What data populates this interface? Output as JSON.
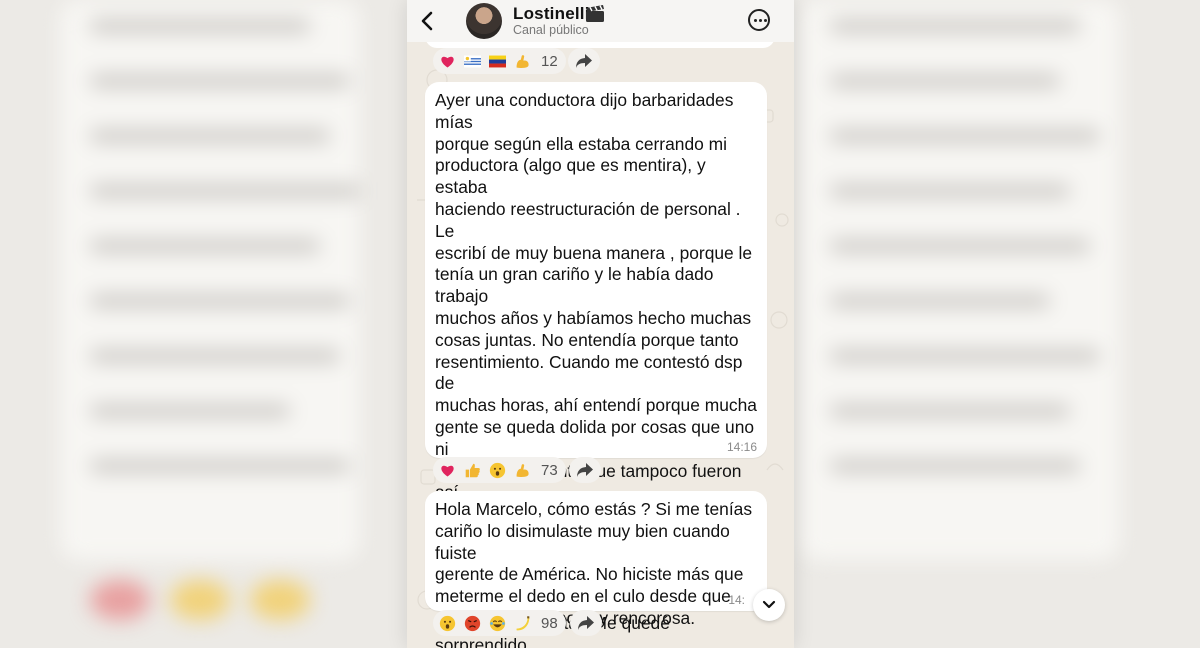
{
  "header": {
    "channel_name": "Lostinelli",
    "channel_type": "Canal público"
  },
  "messages": [
    {
      "text": "Ayer una conductora dijo barbaridades mías\nporque según ella estaba cerrando mi\nproductora (algo que es mentira), y estaba\nhaciendo reestructuración de personal . Le\nescribí de muy buena manera , porque le\ntenía un gran cariño y le había dado trabajo\nmuchos años y habíamos hecho muchas\ncosas juntas. No entendía porque tanto\nresentimiento. Cuando me contestó dsp de\nmuchas horas, ahí entendí porque mucha\ngente se queda dolida por cosas que uno ni\nse entera , y siento que tampoco fueron así.\nGracias a Dios sé entender y perdonar a la\ngente que intenta ofender, porque siento\nque lo que dijo habla más de ella que de mi.\nMiren la respuesta . Me quedé sorprendido.",
      "time": "14:16"
    },
    {
      "text": "Hola Marcelo, cómo estás ? Si me tenías\ncariño lo disimulaste muy bien cuando fuiste\ngerente de América. No hiciste más que\nmeterme el dedo en el culo desde que\nasumiste. Igual no soy rencorosa.",
      "time": "14:"
    }
  ],
  "reactions": [
    {
      "emojis": [
        "heart-icon",
        "uruguay-flag-icon",
        "venezuela-flag-icon",
        "flexed-biceps-icon"
      ],
      "count": "12"
    },
    {
      "emojis": [
        "heart-icon",
        "thumbs-up-icon",
        "surprised-face-icon",
        "flexed-biceps-icon"
      ],
      "count": "73"
    },
    {
      "emojis": [
        "surprised-face-icon",
        "angry-face-icon",
        "laughing-face-icon",
        "banana-icon"
      ],
      "count": "98"
    }
  ],
  "colors": {
    "chat_background": "#efeae2",
    "bubble": "#ffffff",
    "heart": "#e0245e",
    "text": "#111111"
  }
}
